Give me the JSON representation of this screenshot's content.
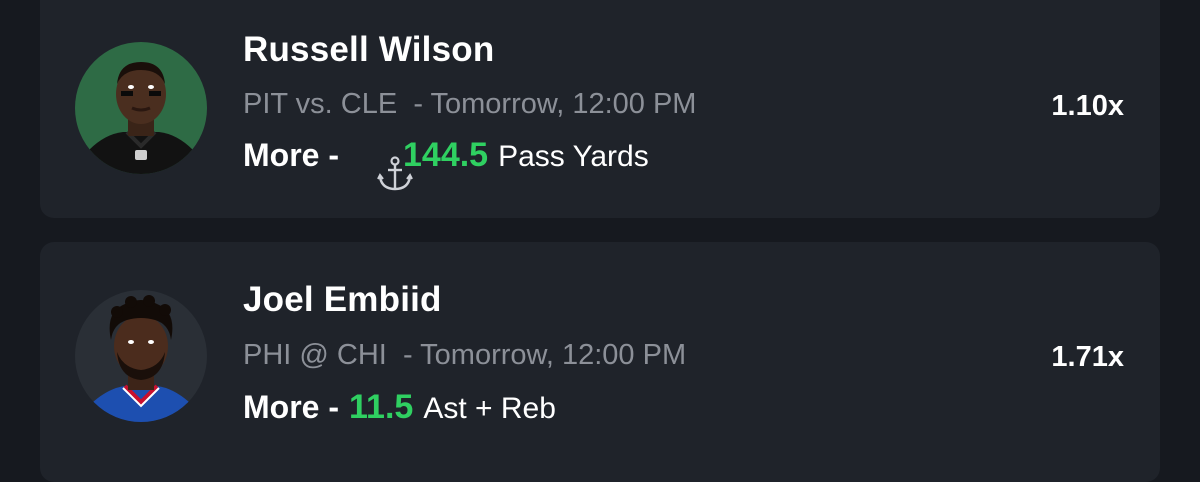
{
  "picks": [
    {
      "player": "Russell Wilson",
      "matchup": "PIT vs. CLE",
      "time": "- Tomorrow, 12:00 PM",
      "direction": "More",
      "separator": "-",
      "anchor_icon": "anchor-icon",
      "line": "144.5",
      "stat": "Pass Yards",
      "multiplier": "1.10x"
    },
    {
      "player": "Joel Embiid",
      "matchup": "PHI @ CHI",
      "time": "- Tomorrow, 12:00 PM",
      "direction": "More",
      "separator": "-",
      "line": "11.5",
      "stat": "Ast + Reb",
      "multiplier": "1.71x"
    }
  ],
  "colors": {
    "background": "#16191f",
    "card": "#1f232a",
    "accent_green": "#2fd061",
    "muted_text": "#8c9098"
  }
}
